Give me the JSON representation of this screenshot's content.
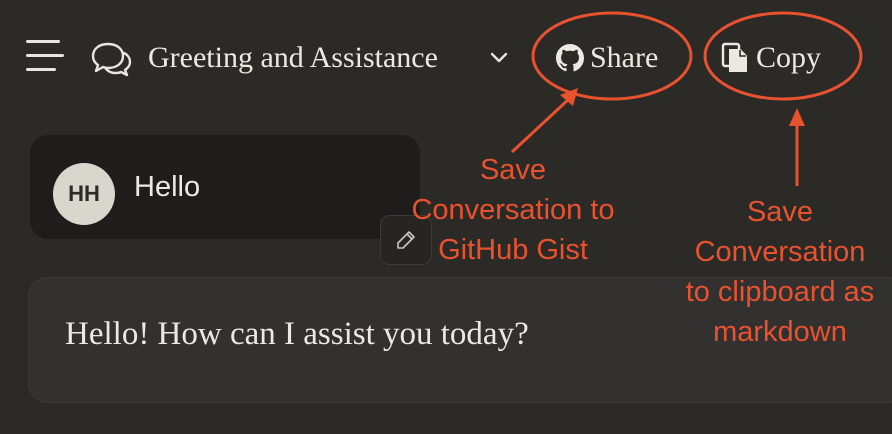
{
  "header": {
    "title": "Greeting and Assistance",
    "share_label": "Share",
    "copy_label": "Copy"
  },
  "conversation": {
    "user": {
      "initials": "HH",
      "text": "Hello"
    },
    "assistant": {
      "text": "Hello! How can I assist you today?"
    }
  },
  "annotations": {
    "share": [
      "Save",
      "Conversation to",
      "GitHub Gist"
    ],
    "copy": [
      "Save",
      "Conversation",
      "to clipboard as",
      "markdown"
    ]
  },
  "colors": {
    "background": "#2b2a27",
    "annotation": "#e8522e",
    "text": "#ece9e2"
  }
}
